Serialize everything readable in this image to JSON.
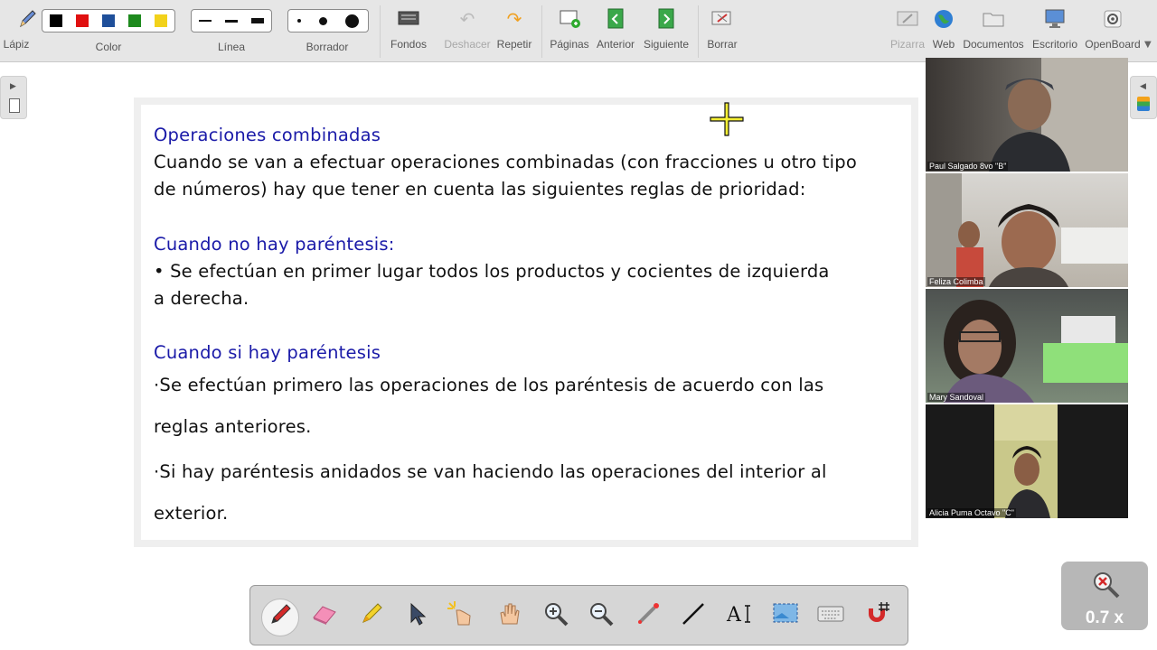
{
  "toolbar": {
    "pen_label": "Lápiz",
    "color_label": "Color",
    "line_label": "Línea",
    "eraser_label": "Borrador",
    "backgrounds_label": "Fondos",
    "undo_label": "Deshacer",
    "redo_label": "Repetir",
    "pages_label": "Páginas",
    "previous_label": "Anterior",
    "next_label": "Siguiente",
    "erase_label": "Borrar",
    "board_label": "Pizarra",
    "web_label": "Web",
    "documents_label": "Documentos",
    "desktop_label": "Escritorio",
    "openboard_label": "OpenBoard",
    "colors": [
      "#000000",
      "#e01010",
      "#1f4f9a",
      "#1e8a1e",
      "#f2d21b"
    ]
  },
  "slide": {
    "title": "Operaciones combinadas",
    "intro_1": "Cuando se van a efectuar operaciones combinadas (con fracciones u otro tipo",
    "intro_2": "de números) hay que tener en cuenta las siguientes reglas de prioridad:",
    "section1_heading": "Cuando no hay paréntesis:",
    "section1_line1": "• Se efectúan en primer lugar todos los productos y cocientes de izquierda",
    "section1_line2": "a derecha.",
    "section2_heading": "Cuando si hay paréntesis",
    "section2_line1": "·Se efectúan primero las operaciones de los paréntesis de acuerdo con las",
    "section2_line2": "reglas anteriores.",
    "section2_line3": "·Si hay paréntesis anidados se van haciendo las operaciones del interior al",
    "section2_line4": "exterior."
  },
  "participants": [
    {
      "name": "Paul Salgado 8vo \"B\""
    },
    {
      "name": "Feliza Colimba"
    },
    {
      "name": "Mary Sandoval"
    },
    {
      "name": "Alicia Puma Octavo \"C\""
    }
  ],
  "zoom": {
    "value": "0.7 x"
  },
  "icons": {
    "tools": [
      "pen-icon",
      "eraser-icon",
      "highlighter-icon",
      "pointer-icon",
      "laser-icon",
      "hand-icon",
      "zoom-in-icon",
      "zoom-out-icon",
      "eyedropper-icon",
      "line-icon",
      "text-icon",
      "capture-icon",
      "keyboard-icon",
      "magnet-grid-icon"
    ]
  }
}
